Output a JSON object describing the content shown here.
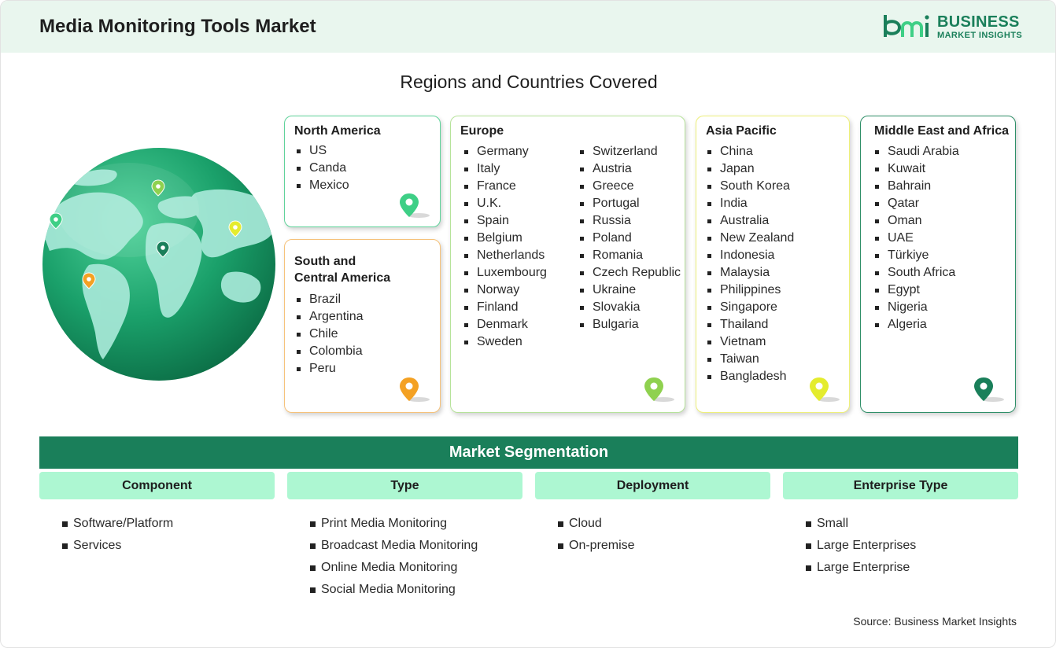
{
  "header": {
    "title": "Media Monitoring Tools Market",
    "logo_line1": "BUSINESS",
    "logo_line2": "MARKET INSIGHTS",
    "logo_mark": "bmi"
  },
  "regions_title": "Regions and Countries Covered",
  "regions": {
    "north_america": {
      "title": "North America",
      "pin_color": "#3ecf86",
      "countries": [
        "US",
        "Canda",
        "Mexico"
      ]
    },
    "south_america": {
      "title_line1": "South and",
      "title_line2": "Central America",
      "pin_color": "#f4a123",
      "countries": [
        "Brazil",
        "Argentina",
        "Chile",
        "Colombia",
        "Peru"
      ]
    },
    "europe": {
      "title": "Europe",
      "pin_color": "#8fd14f",
      "col1": [
        "Germany",
        "Italy",
        "France",
        "U.K.",
        "Spain",
        "Belgium",
        "Netherlands",
        "Luxembourg",
        "Norway",
        "Finland",
        "Denmark",
        "Sweden"
      ],
      "col2": [
        "Switzerland",
        "Austria",
        "Greece",
        "Portugal",
        "Russia",
        "Poland",
        "Romania",
        "Czech Republic",
        "Ukraine",
        "Slovakia",
        "Bulgaria"
      ]
    },
    "asia_pacific": {
      "title": "Asia Pacific",
      "pin_color": "#e4ec2e",
      "countries": [
        "China",
        "Japan",
        "South Korea",
        "India",
        "Australia",
        "New Zealand",
        "Indonesia",
        "Malaysia",
        "Philippines",
        "Singapore",
        "Thailand",
        "Vietnam",
        "Taiwan",
        "Bangladesh"
      ]
    },
    "mea": {
      "title": "Middle East and Africa",
      "pin_color": "#1a7f5a",
      "countries": [
        "Saudi Arabia",
        "Kuwait",
        "Bahrain",
        "Qatar",
        "Oman",
        "UAE",
        "Türkiye",
        "South Africa",
        "Egypt",
        "Nigeria",
        "Algeria"
      ]
    }
  },
  "segmentation": {
    "title": "Market Segmentation",
    "columns": [
      {
        "heading": "Component",
        "items": [
          "Software/Platform",
          "Services"
        ]
      },
      {
        "heading": "Type",
        "items": [
          "Print Media Monitoring",
          "Broadcast Media Monitoring",
          "Online Media Monitoring",
          "Social Media Monitoring"
        ]
      },
      {
        "heading": "Deployment",
        "items": [
          "Cloud",
          "On-premise"
        ]
      },
      {
        "heading": "Enterprise Type",
        "items": [
          "Small",
          "Large Enterprises",
          "Large Enterprise"
        ]
      }
    ]
  },
  "source": "Source: Business Market Insights",
  "colors": {
    "brand_green": "#1a7f5a",
    "header_bg": "#e9f6ee",
    "segment_head_bg": "#adf7d2",
    "border_north_america": "#5fd39a",
    "border_south_america": "#f6c27a",
    "border_europe": "#b6e39a",
    "border_asia_pacific": "#eef07a",
    "border_mea": "#2f8f68"
  }
}
